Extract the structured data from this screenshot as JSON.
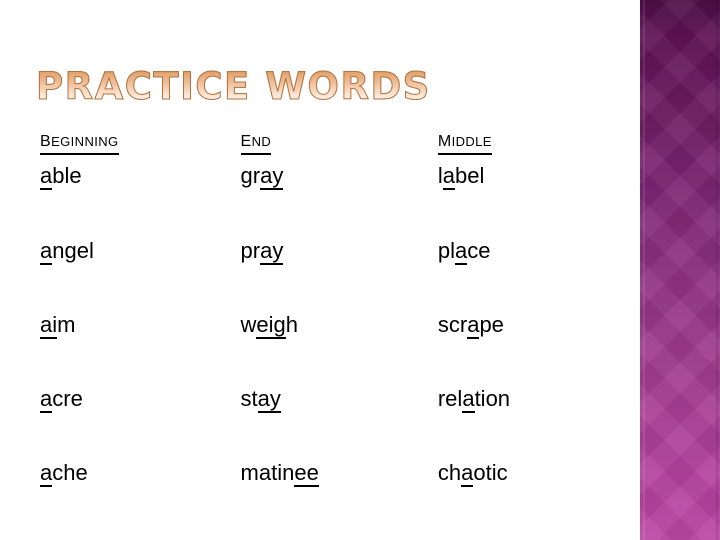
{
  "slide": {
    "title": "PRACTICE WORDS",
    "title_gradient_top": "#d99a5c",
    "title_gradient_bottom": "#fff9f4",
    "title_outline": "#b5703c",
    "background": "#ffffff"
  },
  "side_band": {
    "gradient_top": "#4e0f46",
    "gradient_mid": "#8b3080",
    "gradient_bottom": "#bb49a4"
  },
  "table": {
    "headers": [
      {
        "label": "Beginning"
      },
      {
        "label": "End"
      },
      {
        "label": "Middle"
      }
    ],
    "rows": [
      {
        "beginning": {
          "pre": "",
          "mark": "a",
          "post": "ble",
          "full": "able"
        },
        "end": {
          "pre": "gr",
          "mark": "ay",
          "post": "",
          "full": "gray"
        },
        "middle": {
          "pre": "l",
          "mark": "a",
          "post": "bel",
          "full": "label"
        }
      },
      {
        "beginning": {
          "pre": "",
          "mark": "a",
          "post": "ngel",
          "full": "angel"
        },
        "end": {
          "pre": "pr",
          "mark": "ay",
          "post": "",
          "full": "pray"
        },
        "middle": {
          "pre": "pl",
          "mark": "a",
          "post": "ce",
          "full": "place"
        }
      },
      {
        "beginning": {
          "pre": "",
          "mark": "ai",
          "post": "m",
          "full": "aim"
        },
        "end": {
          "pre": "w",
          "mark": "eig",
          "post": "h",
          "full": "weigh"
        },
        "middle": {
          "pre": "scr",
          "mark": "a",
          "post": "pe",
          "full": "scrape"
        }
      },
      {
        "beginning": {
          "pre": "",
          "mark": "a",
          "post": "cre",
          "full": "acre"
        },
        "end": {
          "pre": "st",
          "mark": "ay",
          "post": "",
          "full": "stay"
        },
        "middle": {
          "pre": "rel",
          "mark": "a",
          "post": "tion",
          "full": "relation"
        }
      },
      {
        "beginning": {
          "pre": "",
          "mark": "a",
          "post": "che",
          "full": "ache"
        },
        "end": {
          "pre": "matin",
          "mark": "ee",
          "post": "",
          "full": "matinee"
        },
        "middle": {
          "pre": "ch",
          "mark": "a",
          "post": "otic",
          "full": "chaotic"
        }
      }
    ]
  }
}
